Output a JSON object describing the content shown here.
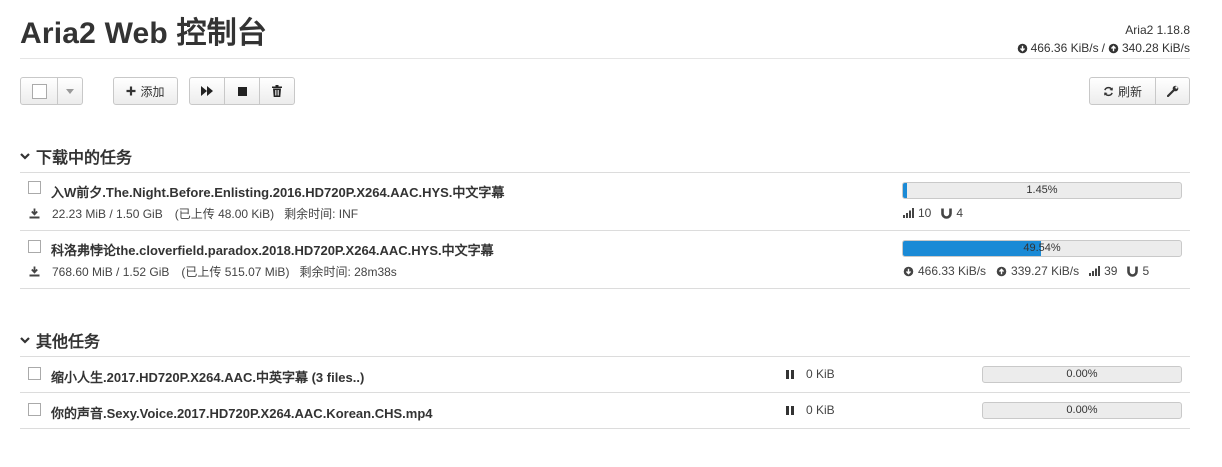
{
  "app": {
    "title": "Aria2 Web 控制台",
    "version": "Aria2 1.18.8",
    "download_speed": "466.36 KiB/s",
    "separator": "/",
    "upload_speed": "340.28 KiB/s"
  },
  "toolbar": {
    "add_label": "添加",
    "refresh_label": "刷新"
  },
  "sections": {
    "active_title": "下载中的任务",
    "other_title": "其他任务"
  },
  "active_tasks": [
    {
      "name": "入W前夕.The.Night.Before.Enlisting.2016.HD720P.X264.AAC.HYS.中文字幕",
      "size": "22.23 MiB / 1.50 GiB",
      "uploaded": "(已上传 48.00 KiB)",
      "remaining": "剩余时间: INF",
      "progress_label": "1.45%",
      "progress": 0.0145,
      "connections": "10",
      "seeds": "4"
    },
    {
      "name": "科洛弗悖论the.cloverfield.paradox.2018.HD720P.X264.AAC.HYS.中文字幕",
      "size": "768.60 MiB / 1.52 GiB",
      "uploaded": "(已上传 515.07 MiB)",
      "remaining": "剩余时间: 28m38s",
      "progress_label": "49.54%",
      "progress": 0.4954,
      "down_speed": "466.33 KiB/s",
      "up_speed": "339.27 KiB/s",
      "connections": "39",
      "seeds": "5"
    }
  ],
  "other_tasks": [
    {
      "name": "缩小人生.2017.HD720P.X264.AAC.中英字幕 (3 files..)",
      "size": "0 KiB",
      "progress_label": "0.00%",
      "progress": 0
    },
    {
      "name": "你的声音.Sexy.Voice.2017.HD720P.X264.AAC.Korean.CHS.mp4",
      "size": "0 KiB",
      "progress_label": "0.00%",
      "progress": 0
    }
  ],
  "colors": {
    "accent": "#1a8ad6"
  }
}
